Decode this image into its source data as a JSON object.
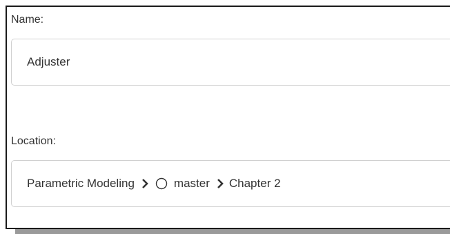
{
  "form": {
    "name_label": "Name:",
    "name_value": "Adjuster",
    "location_label": "Location:",
    "location_path": [
      {
        "label": "Parametric Modeling"
      },
      {
        "label": "master",
        "icon": "branch-circle-icon"
      },
      {
        "label": "Chapter 2"
      }
    ]
  }
}
